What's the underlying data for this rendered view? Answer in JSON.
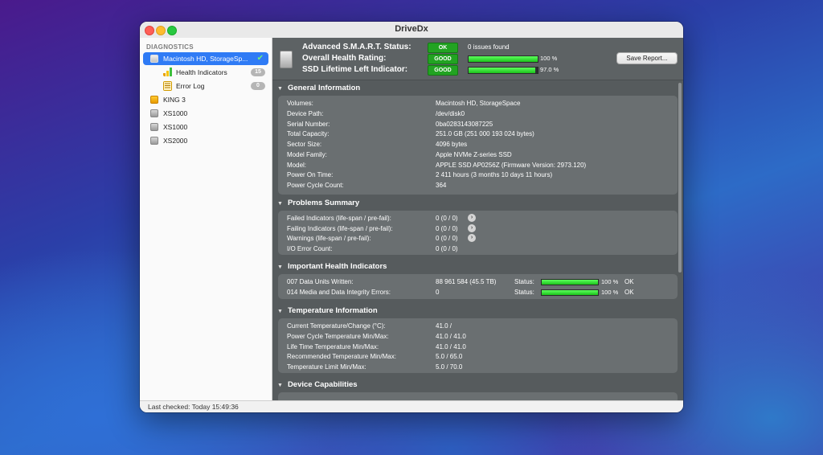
{
  "window": {
    "title": "DriveDx"
  },
  "sidebar": {
    "heading": "DIAGNOSTICS",
    "items": [
      {
        "label": "Macintosh HD, StorageSp...",
        "icon": "disk-icon",
        "selected": true,
        "status_icon": "checkmark-icon"
      },
      {
        "label": "Health Indicators",
        "icon": "bar-chart-icon",
        "badge": "15"
      },
      {
        "label": "Error Log",
        "icon": "log-icon",
        "badge": "0"
      },
      {
        "label": "KING 3",
        "icon": "usb-drive-icon"
      },
      {
        "label": "XS1000",
        "icon": "disk-icon"
      },
      {
        "label": "XS1000",
        "icon": "disk-icon"
      },
      {
        "label": "XS2000",
        "icon": "disk-icon"
      }
    ]
  },
  "status_bar": {
    "text": "Last checked: Today 15:49:36"
  },
  "summary": {
    "smart_label": "Advanced S.M.A.R.T. Status:",
    "smart_badge": "OK",
    "smart_text": "0 issues found",
    "health_label": "Overall Health Rating:",
    "health_badge": "GOOD",
    "health_pct": "100 %",
    "health_value": 100,
    "ssd_label": "SSD Lifetime Left Indicator:",
    "ssd_badge": "GOOD",
    "ssd_pct": "97.0 %",
    "ssd_value": 97,
    "save_button": "Save Report...",
    "accent_green": "#22a322"
  },
  "general": {
    "title": "General Information",
    "rows": [
      {
        "label": "Volumes:",
        "value": "Macintosh HD, StorageSpace"
      },
      {
        "label": "Device Path:",
        "value": "/dev/disk0"
      },
      {
        "label": "Serial Number:",
        "value": "0ba0283143087225"
      },
      {
        "label": "Total Capacity:",
        "value": "251.0 GB (251 000 193 024 bytes)"
      },
      {
        "label": "Sector Size:",
        "value": "4096 bytes"
      },
      {
        "label": "Model Family:",
        "value": "Apple NVMe Z-series SSD"
      },
      {
        "label": "Model:",
        "value": "APPLE SSD AP0256Z  (Firmware Version: 2973.120)"
      },
      {
        "label": "Power On Time:",
        "value": "2 411 hours (3 months 10 days 11 hours)"
      },
      {
        "label": "Power Cycle Count:",
        "value": "364"
      }
    ]
  },
  "problems": {
    "title": "Problems Summary",
    "rows": [
      {
        "label": "Failed Indicators (life-span / pre-fail):",
        "value": "0 (0 / 0)"
      },
      {
        "label": "Failing Indicators (life-span / pre-fail):",
        "value": "0 (0 / 0)"
      },
      {
        "label": "Warnings (life-span / pre-fail):",
        "value": "0 (0 / 0)"
      },
      {
        "label": "I/O Error Count:",
        "value": "0 (0 / 0)"
      }
    ]
  },
  "health": {
    "title": "Important Health Indicators",
    "rows": [
      {
        "label": "007  Data Units Written:",
        "value": "88 961 584 (45.5 TB)",
        "status_label": "Status:",
        "pct": "100 %",
        "pct_value": 100,
        "state": "OK"
      },
      {
        "label": "014  Media and Data Integrity Errors:",
        "value": "0",
        "status_label": "Status:",
        "pct": "100 %",
        "pct_value": 100,
        "state": "OK"
      }
    ]
  },
  "temperature": {
    "title": "Temperature Information",
    "rows": [
      {
        "label": "Current Temperature/Change (°C):",
        "value": "41.0 /"
      },
      {
        "label": "Power Cycle Temperature Min/Max:",
        "value": "41.0 / 41.0"
      },
      {
        "label": "Life Time Temperature Min/Max:",
        "value": "41.0 / 41.0"
      },
      {
        "label": "Recommended Temperature Min/Max:",
        "value": "5.0   / 65.0"
      },
      {
        "label": "Temperature Limit Min/Max:",
        "value": "5.0   / 70.0"
      }
    ]
  },
  "capabilities": {
    "title": "Device Capabilities"
  }
}
